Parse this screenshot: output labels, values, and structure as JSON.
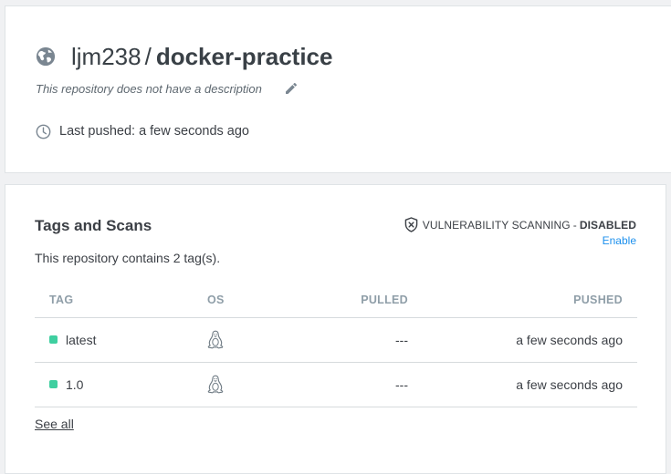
{
  "repository": {
    "namespace": "ljm238",
    "separator": "/",
    "name": "docker-practice",
    "description": "This repository does not have a description",
    "last_pushed": "Last pushed: a few seconds ago"
  },
  "tags_section": {
    "title": "Tags and Scans",
    "count_text": "This repository contains 2 tag(s).",
    "scanning_label": "VULNERABILITY SCANNING",
    "scanning_separator": "-",
    "scanning_state": "DISABLED",
    "enable_link": "Enable",
    "columns": [
      "TAG",
      "OS",
      "PULLED",
      "PUSHED"
    ],
    "rows": [
      {
        "tag": "latest",
        "os_icon": "linux-icon",
        "pulled": "---",
        "pushed": "a few seconds ago"
      },
      {
        "tag": "1.0",
        "os_icon": "linux-icon",
        "pulled": "---",
        "pushed": "a few seconds ago"
      }
    ],
    "see_all": "See all"
  },
  "colors": {
    "tag_dot": "#3fcfa0",
    "link": "#1c90ed",
    "header_muted": "#8f9ea8"
  },
  "icons": {
    "visibility": "globe-icon",
    "edit": "pencil-icon",
    "time": "clock-icon",
    "scan": "shield-x-icon"
  }
}
